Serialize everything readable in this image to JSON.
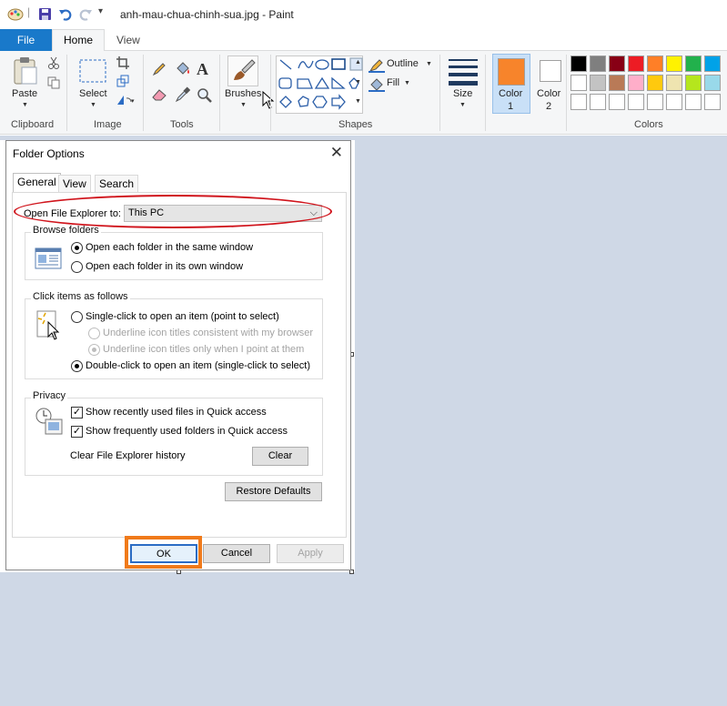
{
  "app": {
    "title": "anh-mau-chua-chinh-sua.jpg - Paint",
    "tabs": {
      "file": "File",
      "home": "Home",
      "view": "View"
    }
  },
  "ribbon": {
    "clipboard": {
      "paste": "Paste",
      "group": "Clipboard"
    },
    "image": {
      "select": "Select",
      "group": "Image"
    },
    "tools": {
      "group": "Tools",
      "text_glyph": "A"
    },
    "brushes": "Brushes",
    "shapes": {
      "outline": "Outline",
      "fill": "Fill",
      "group": "Shapes"
    },
    "size": "Size",
    "color1": {
      "label": "Color",
      "num": "1",
      "value": "#f7842b"
    },
    "color2": {
      "label": "Color",
      "num": "2",
      "value": "#ffffff"
    },
    "colors_group": "Colors",
    "palette_row1": [
      "#000000",
      "#7f7f7f",
      "#880015",
      "#ed1c24",
      "#ff7f27",
      "#fff200",
      "#22b14c",
      "#00a2e8"
    ],
    "palette_row2": [
      "#ffffff",
      "#c3c3c3",
      "#b97a57",
      "#ffaec9",
      "#ffc90e",
      "#efe4b0",
      "#b5e61d",
      "#99d9ea"
    ]
  },
  "dialog": {
    "title": "Folder Options",
    "close": "✕",
    "tabs": {
      "general": "General",
      "view": "View",
      "search": "Search"
    },
    "open_explorer_label": "Open File Explorer to:",
    "open_explorer_value": "This PC",
    "browse": {
      "legend": "Browse folders",
      "same_window": "Open each folder in the same window",
      "own_window": "Open each folder in its own window"
    },
    "click": {
      "legend": "Click items as follows",
      "single": "Single-click to open an item (point to select)",
      "underline_consistent": "Underline icon titles consistent with my browser",
      "underline_point": "Underline icon titles only when I point at them",
      "double": "Double-click to open an item (single-click to select)"
    },
    "privacy": {
      "legend": "Privacy",
      "recent_files": "Show recently used files in Quick access",
      "frequent_folders": "Show frequently used folders in Quick access",
      "clear_label": "Clear File Explorer history",
      "clear_button": "Clear"
    },
    "restore_defaults": "Restore Defaults",
    "ok": "OK",
    "cancel": "Cancel",
    "apply": "Apply",
    "check_mark": "✓"
  }
}
